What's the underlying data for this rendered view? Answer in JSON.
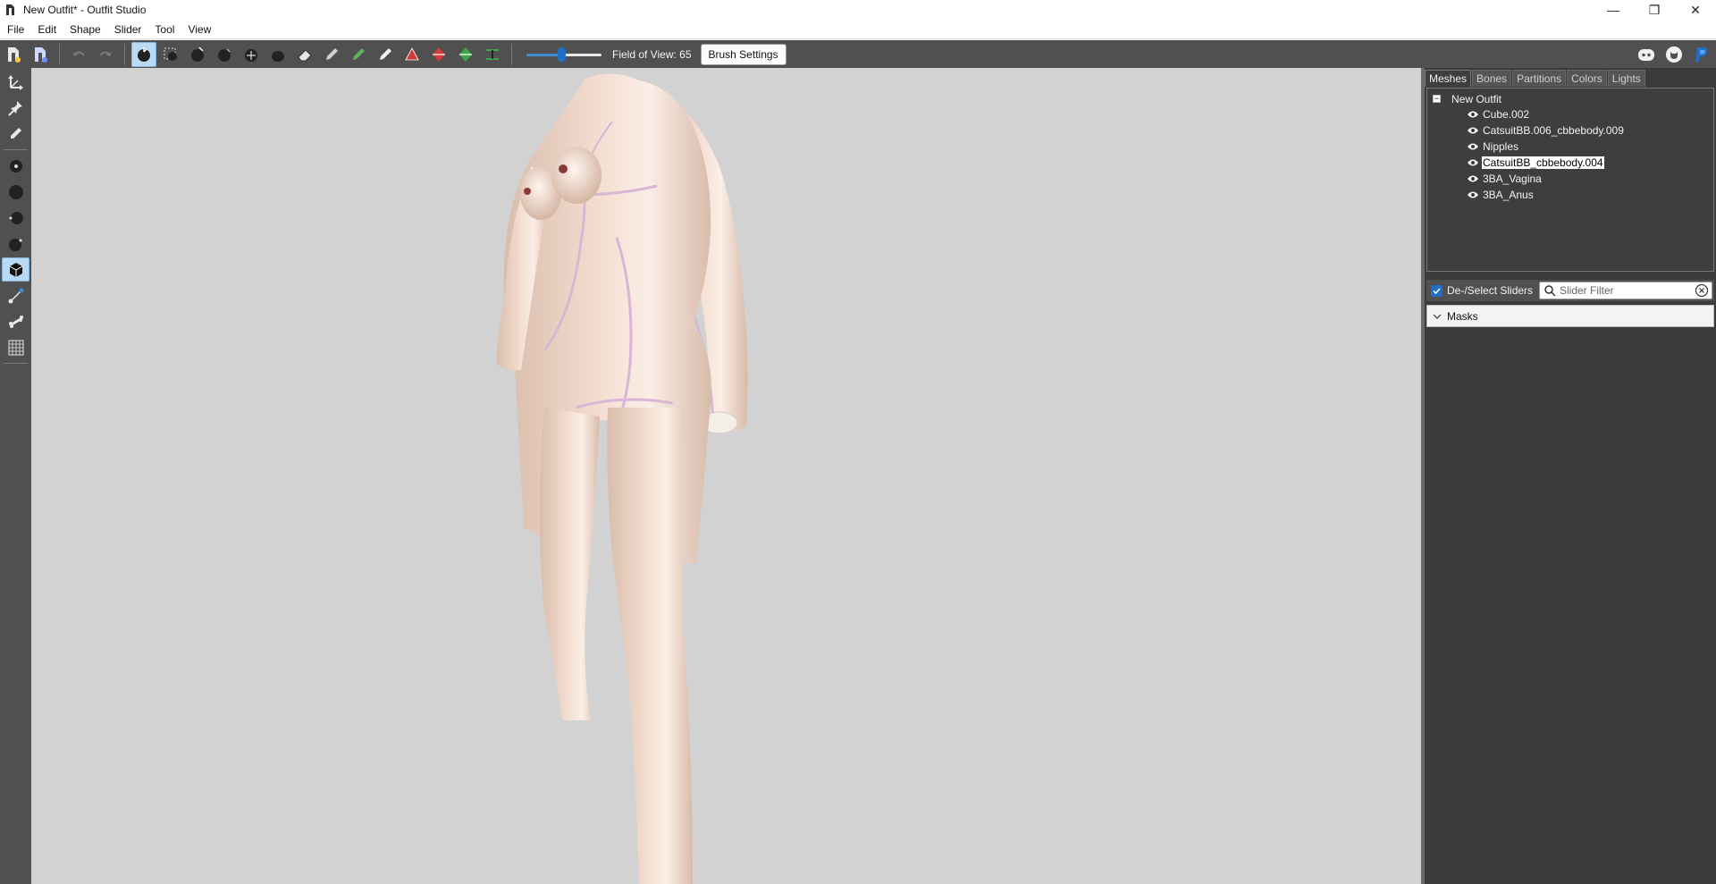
{
  "window": {
    "title": "New Outfit* - Outfit Studio",
    "controls": {
      "minimize": "—",
      "restore": "❐",
      "close": "✕"
    }
  },
  "menu": {
    "items": [
      "File",
      "Edit",
      "Shape",
      "Slider",
      "Tool",
      "View"
    ]
  },
  "toolbar": {
    "fov_label": "Field of View: 65",
    "fov_level": 0.47,
    "brush_settings_label": "Brush Settings",
    "tools": [
      "load-reference-icon",
      "load-outfit-icon",
      "undo-icon",
      "redo-icon",
      "select-brush-icon",
      "mask-select-icon",
      "inflate-brush-icon",
      "deflate-brush-icon",
      "move-brush-icon",
      "smooth-brush-icon",
      "eraser-icon",
      "weight-brush-icon",
      "color-brush-icon",
      "alpha-brush-icon",
      "triangle-red-icon",
      "mirror-red-icon",
      "mirror-green-icon",
      "collapse-vertex-icon"
    ],
    "external": [
      "discord-icon",
      "github-icon",
      "paypal-icon"
    ]
  },
  "leftbar": {
    "tools": [
      "transform-icon",
      "pivot-icon",
      "pencil-icon",
      "brush-size-small-icon",
      "brush-size-large-icon",
      "brush-strength-icon",
      "brush-focus-icon",
      "cube-select-icon",
      "vertex-edit-icon",
      "bone-icon",
      "grid-icon"
    ],
    "active_tool": "cube-select-icon"
  },
  "panel": {
    "tabs": [
      "Meshes",
      "Bones",
      "Partitions",
      "Colors",
      "Lights"
    ],
    "active_tab": "Meshes",
    "tree": {
      "root": "New Outfit",
      "items": [
        {
          "label": "Cube.002",
          "selected": false
        },
        {
          "label": "CatsuitBB.006_cbbebody.009",
          "selected": false
        },
        {
          "label": "Nipples",
          "selected": false
        },
        {
          "label": "CatsuitBB_cbbebody.004",
          "selected": true
        },
        {
          "label": "3BA_Vagina",
          "selected": false
        },
        {
          "label": "3BA_Anus",
          "selected": false
        }
      ]
    },
    "sliders": {
      "deselect_label": "De-/Select Sliders",
      "filter_placeholder": "Slider Filter",
      "masks_label": "Masks"
    }
  },
  "colors": {
    "chrome_dark": "#505050",
    "viewport_bg": "#d2d2d2",
    "accent": "#1f6fc5",
    "model_skin": "#ecd3c4",
    "seam": "#d9b6d6"
  }
}
